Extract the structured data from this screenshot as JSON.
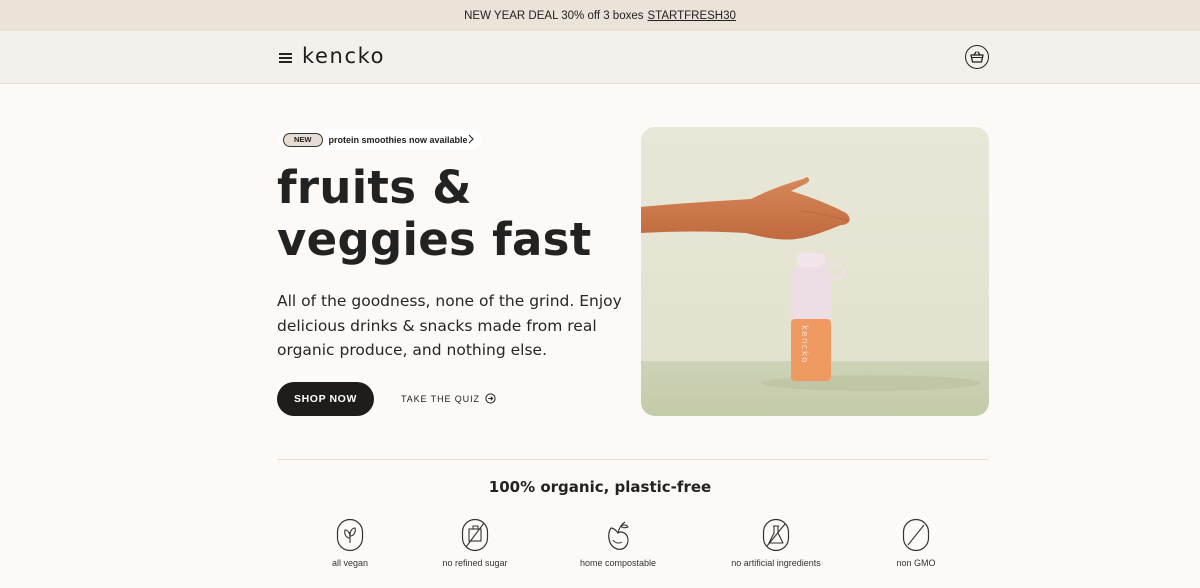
{
  "promo": {
    "text": "NEW YEAR DEAL 30% off 3 boxes",
    "code": "STARTFRESH30"
  },
  "header": {
    "logo": "kencko",
    "menu_icon": "hamburger-menu-icon",
    "cart_icon": "basket-icon"
  },
  "hero": {
    "badge_label": "NEW",
    "badge_text": "protein smoothies now available",
    "title_line1": "fruits &",
    "title_line2": "veggies fast",
    "description": "All of the goodness, none of the grind. Enjoy delicious drinks & snacks made from real organic produce, and nothing else.",
    "primary_button": "SHOP NOW",
    "secondary_link": "TAKE THE QUIZ",
    "bottle_label": "kencko"
  },
  "features": {
    "title": "100% organic, plastic-free",
    "items": [
      {
        "label": "all vegan",
        "icon": "leaf-icon"
      },
      {
        "label": "no refined sugar",
        "icon": "no-sugar-icon"
      },
      {
        "label": "home compostable",
        "icon": "compost-icon"
      },
      {
        "label": "no artificial ingredients",
        "icon": "no-artificial-icon"
      },
      {
        "label": "non GMO",
        "icon": "non-gmo-icon"
      }
    ]
  },
  "colors": {
    "promo_bg": "#ebe2d8",
    "header_bg": "#f4f1ec",
    "page_bg": "#fcf9f6",
    "button_bg": "#1e1d1b",
    "bottle_orange": "#ee9a62",
    "bottle_cap": "#efdfe6"
  }
}
